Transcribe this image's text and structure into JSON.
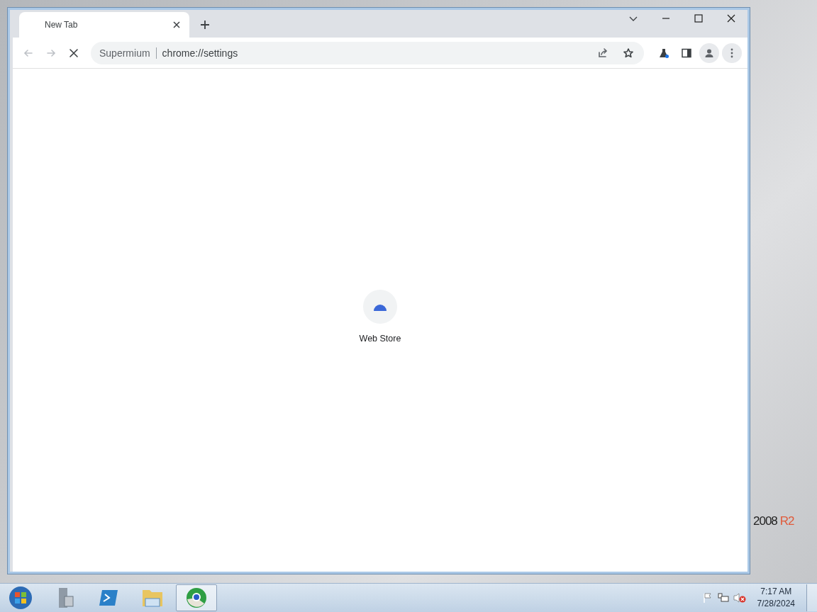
{
  "browser": {
    "tabs": [
      {
        "title": "New Tab",
        "selected": true
      }
    ],
    "address_bar": {
      "site": "Supermium",
      "url": "chrome://settings"
    },
    "loading": true,
    "shortcuts": [
      {
        "label": "Web Store"
      }
    ]
  },
  "desktop": {
    "edition": "2008",
    "edition_suffix": "R2"
  },
  "taskbar": {
    "items": [
      {
        "kind": "server",
        "selected": false
      },
      {
        "kind": "shell",
        "selected": false
      },
      {
        "kind": "folder",
        "selected": false
      },
      {
        "kind": "browser",
        "selected": true
      }
    ],
    "clock": {
      "time": "7:17 AM",
      "date": "7/28/2024"
    }
  }
}
